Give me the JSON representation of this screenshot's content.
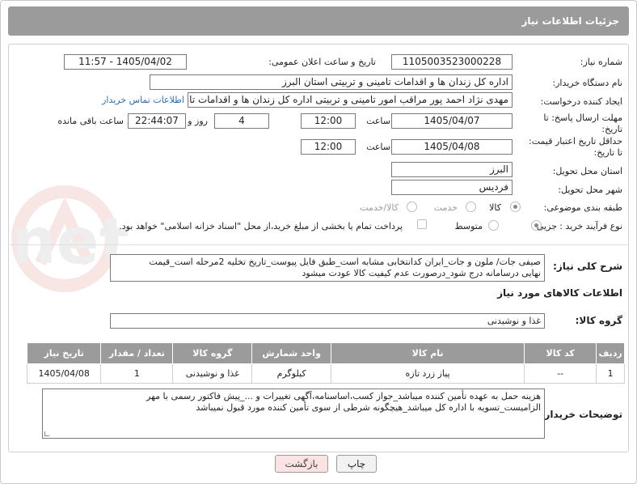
{
  "header": {
    "title": "جزئیات اطلاعات نیاز"
  },
  "form": {
    "need_number": {
      "label": "شماره نیاز:",
      "value": "1105003523000228"
    },
    "announce": {
      "label": "تاریخ و ساعت اعلان عمومی:",
      "value": "1405/04/02 - 11:57"
    },
    "buyer": {
      "label": "نام دستگاه خریدار:",
      "value": "اداره کل زندان ها و اقدامات تامینی و تربیتی استان البرز"
    },
    "creator": {
      "label": "ایجاد کننده درخواست:",
      "value": "مهدی نژاد احمد پور مراقب امور تامینی و تربیتی اداره کل زندان ها و اقدامات تامینی",
      "link": "اطلاعات تماس خریدار"
    },
    "deadline": {
      "label_line1": "مهلت ارسال پاسخ: تا",
      "label_line2": "تاریخ:",
      "date": "1405/04/07",
      "time_label": "ساعت",
      "time": "12:00",
      "days": "4",
      "days_label": "روز و",
      "remaining": "22:44:07",
      "remaining_label": "ساعت باقی مانده"
    },
    "price_validity": {
      "label_line1": "حداقل تاریخ اعتبار قیمت:",
      "label_line2": "تا تاریخ:",
      "date": "1405/04/08",
      "time_label": "ساعت",
      "time": "12:00"
    },
    "province": {
      "label": "استان محل تحویل:",
      "value": "البرز"
    },
    "city": {
      "label": "شهر محل تحویل:",
      "value": "فردیس"
    },
    "category": {
      "label": "طبقه بندی موضوعی:",
      "options": [
        "کالا",
        "خدمت",
        "کالا/خدمت"
      ],
      "selected": "کالا"
    },
    "process": {
      "label": "نوع فرآیند خرید :",
      "options": [
        "جزیی",
        "متوسط"
      ],
      "selected": "جزیی",
      "checkbox_text": "پرداخت تمام یا بخشی از مبلغ خرید،از محل \"اسناد خزانه اسلامی\" خواهد بود."
    }
  },
  "description": {
    "label": "شرح کلی نیاز:",
    "text_line1": "صیفی جات/ ملون و جات_ایران کدانتخابی مشابه است_طبق فایل پیوست_تاریخ تخلیه 2مرحله است_قیمت",
    "text_line2": "نهایی درسامانه درج شود_درصورت عدم کیفیت کالا عودت میشود"
  },
  "goods_info": {
    "title": "اطلاعات کالاهای مورد نیاز",
    "group_label": "گروه کالا:",
    "group_value": "غذا و نوشیدنی"
  },
  "table": {
    "headers": [
      "ردیف",
      "کد کالا",
      "نام کالا",
      "واحد شمارش",
      "گروه کالا",
      "تعداد / مقدار",
      "تاریخ نیاز"
    ],
    "rows": [
      [
        "1",
        "--",
        "پیاز زرد تازه",
        "کیلوگرم",
        "غذا و نوشیدنی",
        "1",
        "1405/04/08"
      ]
    ]
  },
  "buyer_notes": {
    "label": "توضیحات خریدار:",
    "line1": "هزینه حمل به عهده تأمین کننده میباشد_جواز کسب،اساسنامه،آگهی تغییرات و ..._پیش فاکتور رسمی با مهر",
    "line2": "الزامیست_تسویه با اداره کل میباشد_هیچگونه شرطی از سوی تأمین کننده مورد قبول نمیباشد"
  },
  "buttons": {
    "print": "چاپ",
    "back": "بازگشت"
  },
  "watermark": "AriaTender.net"
}
